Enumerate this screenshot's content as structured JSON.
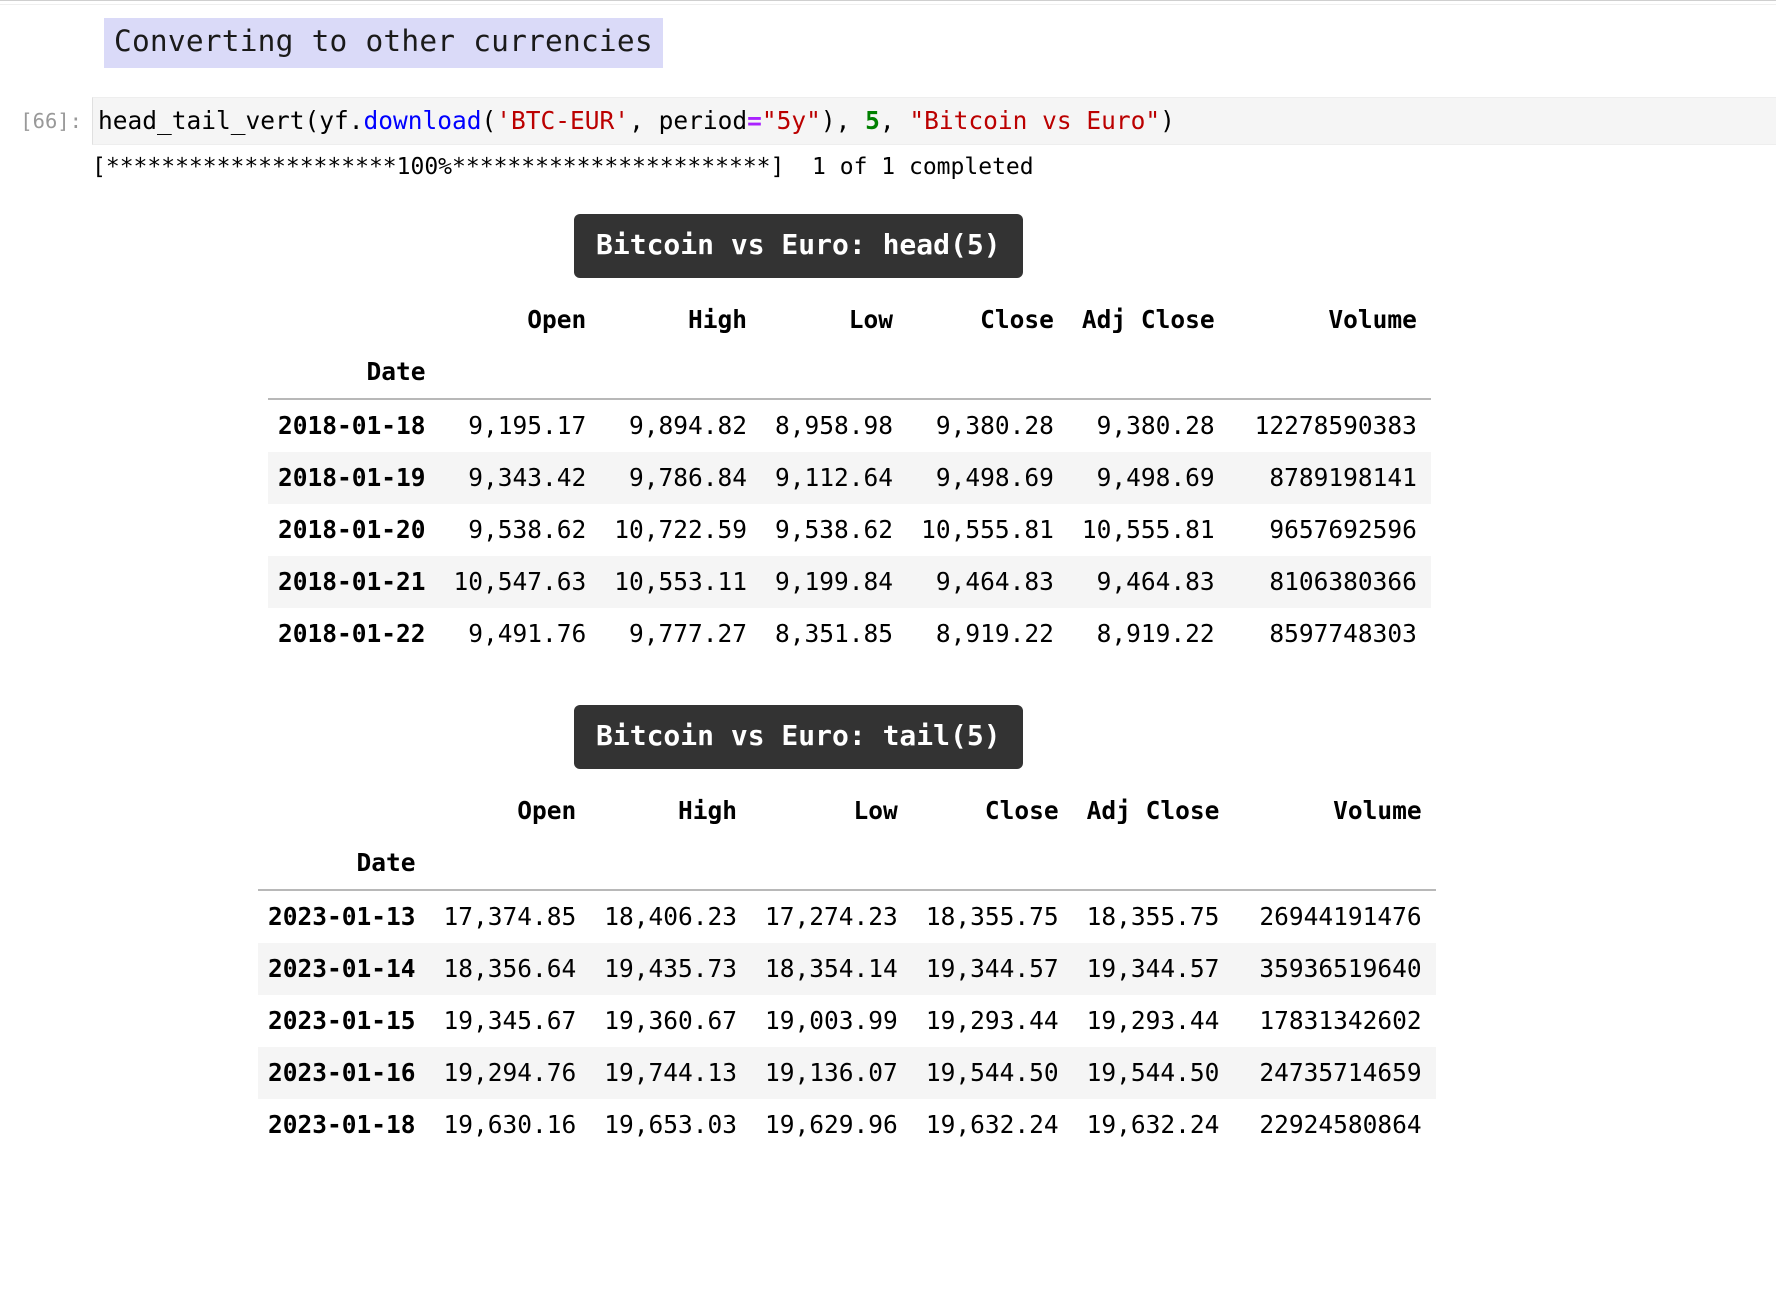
{
  "notebook": {
    "markdown_heading": "Converting to other currencies",
    "cell": {
      "prompt": "[66]:",
      "code_tokens": [
        {
          "text": "head_tail_vert(yf.",
          "type": "plain"
        },
        {
          "text": "download",
          "type": "fn"
        },
        {
          "text": "(",
          "type": "plain"
        },
        {
          "text": "'BTC-EUR'",
          "type": "str"
        },
        {
          "text": ", period",
          "type": "plain"
        },
        {
          "text": "=",
          "type": "op"
        },
        {
          "text": "\"5y\"",
          "type": "str"
        },
        {
          "text": "), ",
          "type": "plain"
        },
        {
          "text": "5",
          "type": "num"
        },
        {
          "text": ", ",
          "type": "plain"
        },
        {
          "text": "\"Bitcoin vs Euro\"",
          "type": "str"
        },
        {
          "text": ")",
          "type": "plain"
        }
      ],
      "code_plain": "head_tail_vert(yf.download('BTC-EUR', period=\"5y\"), 5, \"Bitcoin vs Euro\")",
      "stdout": "[*********************100%***********************]  1 of 1 completed"
    }
  },
  "colors": {
    "heading_highlight": "#dadaf8",
    "caption_background": "#333333",
    "caption_text": "#ffffff",
    "code_background": "#f5f5f5",
    "prompt_text": "#999999",
    "string_token": "#bb0000",
    "function_token": "#0000ff",
    "operator_token": "#aa22ff",
    "number_token": "#008000",
    "row_stripe": "#f5f5f5"
  },
  "tables": [
    {
      "caption": "Bitcoin vs Euro: head(5)",
      "index_name": "Date",
      "columns": [
        "Open",
        "High",
        "Low",
        "Close",
        "Adj Close",
        "Volume"
      ],
      "rows": [
        {
          "date": "2018-01-18",
          "values": [
            "9,195.17",
            "9,894.82",
            "8,958.98",
            "9,380.28",
            "9,380.28",
            "12278590383"
          ]
        },
        {
          "date": "2018-01-19",
          "values": [
            "9,343.42",
            "9,786.84",
            "9,112.64",
            "9,498.69",
            "9,498.69",
            "8789198141"
          ]
        },
        {
          "date": "2018-01-20",
          "values": [
            "9,538.62",
            "10,722.59",
            "9,538.62",
            "10,555.81",
            "10,555.81",
            "9657692596"
          ]
        },
        {
          "date": "2018-01-21",
          "values": [
            "10,547.63",
            "10,553.11",
            "9,199.84",
            "9,464.83",
            "9,464.83",
            "8106380366"
          ]
        },
        {
          "date": "2018-01-22",
          "values": [
            "9,491.76",
            "9,777.27",
            "8,351.85",
            "8,919.22",
            "8,919.22",
            "8597748303"
          ]
        }
      ]
    },
    {
      "caption": "Bitcoin vs Euro: tail(5)",
      "index_name": "Date",
      "columns": [
        "Open",
        "High",
        "Low",
        "Close",
        "Adj Close",
        "Volume"
      ],
      "rows": [
        {
          "date": "2023-01-13",
          "values": [
            "17,374.85",
            "18,406.23",
            "17,274.23",
            "18,355.75",
            "18,355.75",
            "26944191476"
          ]
        },
        {
          "date": "2023-01-14",
          "values": [
            "18,356.64",
            "19,435.73",
            "18,354.14",
            "19,344.57",
            "19,344.57",
            "35936519640"
          ]
        },
        {
          "date": "2023-01-15",
          "values": [
            "19,345.67",
            "19,360.67",
            "19,003.99",
            "19,293.44",
            "19,293.44",
            "17831342602"
          ]
        },
        {
          "date": "2023-01-16",
          "values": [
            "19,294.76",
            "19,744.13",
            "19,136.07",
            "19,544.50",
            "19,544.50",
            "24735714659"
          ]
        },
        {
          "date": "2023-01-18",
          "values": [
            "19,630.16",
            "19,653.03",
            "19,629.96",
            "19,632.24",
            "19,632.24",
            "22924580864"
          ]
        }
      ]
    }
  ]
}
